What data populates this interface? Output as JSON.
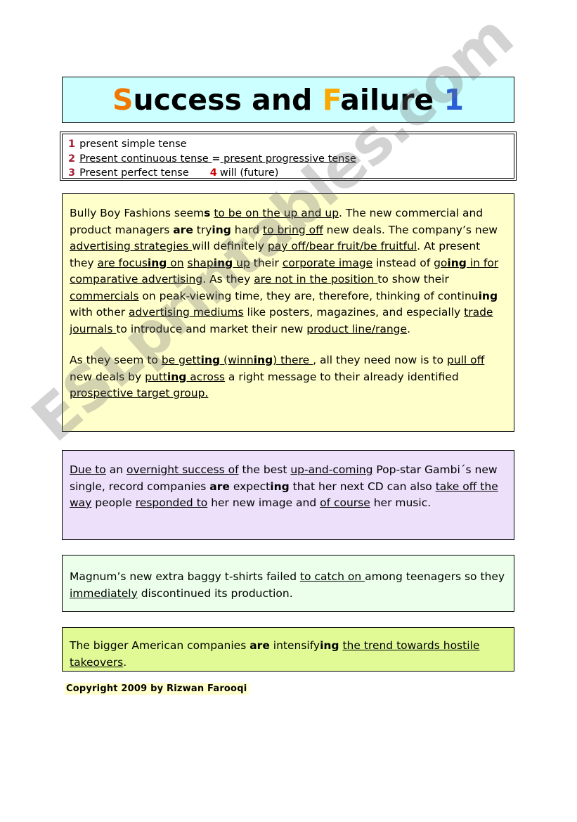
{
  "page": {
    "watermark": "ESLprintables.com",
    "background_color": "#ffffff"
  },
  "title": {
    "full_text": "Success and Failure 1",
    "parts": [
      {
        "text": "S",
        "color": "#f07800"
      },
      {
        "text": "uccess and ",
        "color": "#000000"
      },
      {
        "text": "F",
        "color": "#f9a800"
      },
      {
        "text": "ailure ",
        "color": "#000000"
      },
      {
        "text": "1",
        "color": "#2a5fd8"
      }
    ],
    "box_color": "#ccffff"
  },
  "tense_list": {
    "box_color": "#ffffff",
    "number_color": "#a52036",
    "items": [
      {
        "num": "1",
        "text": "present simple tense"
      },
      {
        "num": "2",
        "text_a": "Present continuous tense ",
        "equals": "=",
        "text_b": " present progressive tense"
      },
      {
        "num": "3",
        "text": "Present perfect tense",
        "num2": "4",
        "text2": "will (future)"
      }
    ]
  },
  "sections": [
    {
      "id": "yellow",
      "color": "#ffffcc",
      "paragraph_1": "Bully Boy Fashions seems to be on the up and up. The new commercial and product managers are trying hard to bring off new deals. The company’s new advertising strategies will definitely pay off/bear fruit/be fruitful. At present they are focusing on shaping up their corporate image instead of going in for comparative advertising. As they are not in the position to show their commercials on peak-viewing time, they are, therefore, thinking of continuing with other advertising mediums like posters, magazines, and especially trade journals to introduce and market their new product line/range.",
      "paragraph_2": "As they seem to be getting (winning) there , all they need now is to pull off new deals by putting across a right message to their already identified prospective target group.",
      "p1_tokens": [
        {
          "t": "Bully Boy Fashions seem"
        },
        {
          "t": "s",
          "b": true
        },
        {
          "t": " "
        },
        {
          "t": "to be on the up and up",
          "u": true
        },
        {
          "t": ". The new commercial and product managers "
        },
        {
          "t": "are",
          "b": true
        },
        {
          "t": " try"
        },
        {
          "t": "ing",
          "b": true
        },
        {
          "t": " hard "
        },
        {
          "t": "to bring off",
          "u": true
        },
        {
          "t": " new deals. The company’s new "
        },
        {
          "t": "advertising strategies ",
          "u": true
        },
        {
          "t": "will definitely "
        },
        {
          "t": "pay off/bear fruit/be fruitful",
          "u": true
        },
        {
          "t": ". At present they "
        },
        {
          "t": "are focus",
          "u": true
        },
        {
          "t": "ing",
          "u": true,
          "b": true
        },
        {
          "t": " on",
          "u": true
        },
        {
          "t": "  "
        },
        {
          "t": "shap",
          "u": true
        },
        {
          "t": "ing",
          "u": true,
          "b": true
        },
        {
          "t": " up",
          "u": true
        },
        {
          "t": " their "
        },
        {
          "t": "corporate image",
          "u": true
        },
        {
          "t": " instead of "
        },
        {
          "t": "go",
          "u": true
        },
        {
          "t": "ing",
          "u": true,
          "b": true
        },
        {
          "t": " in for",
          "u": true
        },
        {
          "t": " "
        },
        {
          "t": "comparative advertising",
          "u": true
        },
        {
          "t": ". As they "
        },
        {
          "t": "are not in the position ",
          "u": true
        },
        {
          "t": "to show their "
        },
        {
          "t": "commercials",
          "u": true
        },
        {
          "t": " on peak-viewing time, they are, therefore, thinking of continu"
        },
        {
          "t": "ing",
          "b": true
        },
        {
          "t": " with other "
        },
        {
          "t": "advertising mediums",
          "u": true
        },
        {
          "t": " like posters, magazines, and especially "
        },
        {
          "t": "trade journals ",
          "u": true
        },
        {
          "t": "to introduce and market their new "
        },
        {
          "t": "product line/range",
          "u": true
        },
        {
          "t": "."
        }
      ],
      "p2_tokens": [
        {
          "t": "As they seem to "
        },
        {
          "t": "be gett",
          "u": true
        },
        {
          "t": "ing",
          "u": true,
          "b": true
        },
        {
          "t": " (winn",
          "u": true
        },
        {
          "t": "ing",
          "u": true,
          "b": true
        },
        {
          "t": ") there ",
          "u": true
        },
        {
          "t": ", all they need now is to "
        },
        {
          "t": "pull off ",
          "u": true
        },
        {
          "t": "new deals by "
        },
        {
          "t": "putt",
          "u": true
        },
        {
          "t": "ing",
          "u": true,
          "b": true
        },
        {
          "t": " across",
          "u": true
        },
        {
          "t": " a right message to their already identified "
        },
        {
          "t": "prospective target group.",
          "u": true
        }
      ]
    },
    {
      "id": "purple",
      "color": "#ece0fa",
      "paragraph": "Due to an overnight success of the best up-and-coming Pop-star Gambi´s new single, record companies are expecting that her next CD can also take off the way people responded to her new image and of course her music.",
      "tokens": [
        {
          "t": "Due to",
          "u": true
        },
        {
          "t": " an "
        },
        {
          "t": "overnight success of",
          "u": true
        },
        {
          "t": " the best "
        },
        {
          "t": "up-and-coming",
          "u": true
        },
        {
          "t": " Pop-star Gambi´s new single, record companies "
        },
        {
          "t": "are",
          "b": true
        },
        {
          "t": " expect"
        },
        {
          "t": "ing",
          "b": true
        },
        {
          "t": " that her next CD can also "
        },
        {
          "t": "take off ",
          "u": true
        },
        {
          "t": " "
        },
        {
          "t": "the way",
          "u": true
        },
        {
          "t": " people "
        },
        {
          "t": "responded to",
          "u": true
        },
        {
          "t": " her new image and "
        },
        {
          "t": "of course",
          "u": true
        },
        {
          "t": " her music."
        }
      ]
    },
    {
      "id": "mint",
      "color": "#ebffeb",
      "paragraph": "Magnum’s new extra baggy t-shirts failed to catch on among teenagers so they immediately discontinued its production.",
      "tokens": [
        {
          "t": "Magnum’s new extra baggy t-shirts failed "
        },
        {
          "t": "to catch on ",
          "u": true
        },
        {
          "t": "among teenagers so they "
        },
        {
          "t": "immediately",
          "u": true
        },
        {
          "t": " discontinued its production."
        }
      ]
    },
    {
      "id": "lime",
      "color": "#e1fa96",
      "paragraph": "The bigger American companies are intensifying the trend towards hostile takeovers.",
      "tokens": [
        {
          "t": "The bigger American companies "
        },
        {
          "t": "are",
          "b": true
        },
        {
          "t": " intensify"
        },
        {
          "t": "ing",
          "b": true
        },
        {
          "t": " "
        },
        {
          "t": "the trend  towards hostile takeovers",
          "u": true
        },
        {
          "t": "."
        }
      ]
    }
  ],
  "copyright": "Copyright 2009 by Rizwan Farooqi"
}
